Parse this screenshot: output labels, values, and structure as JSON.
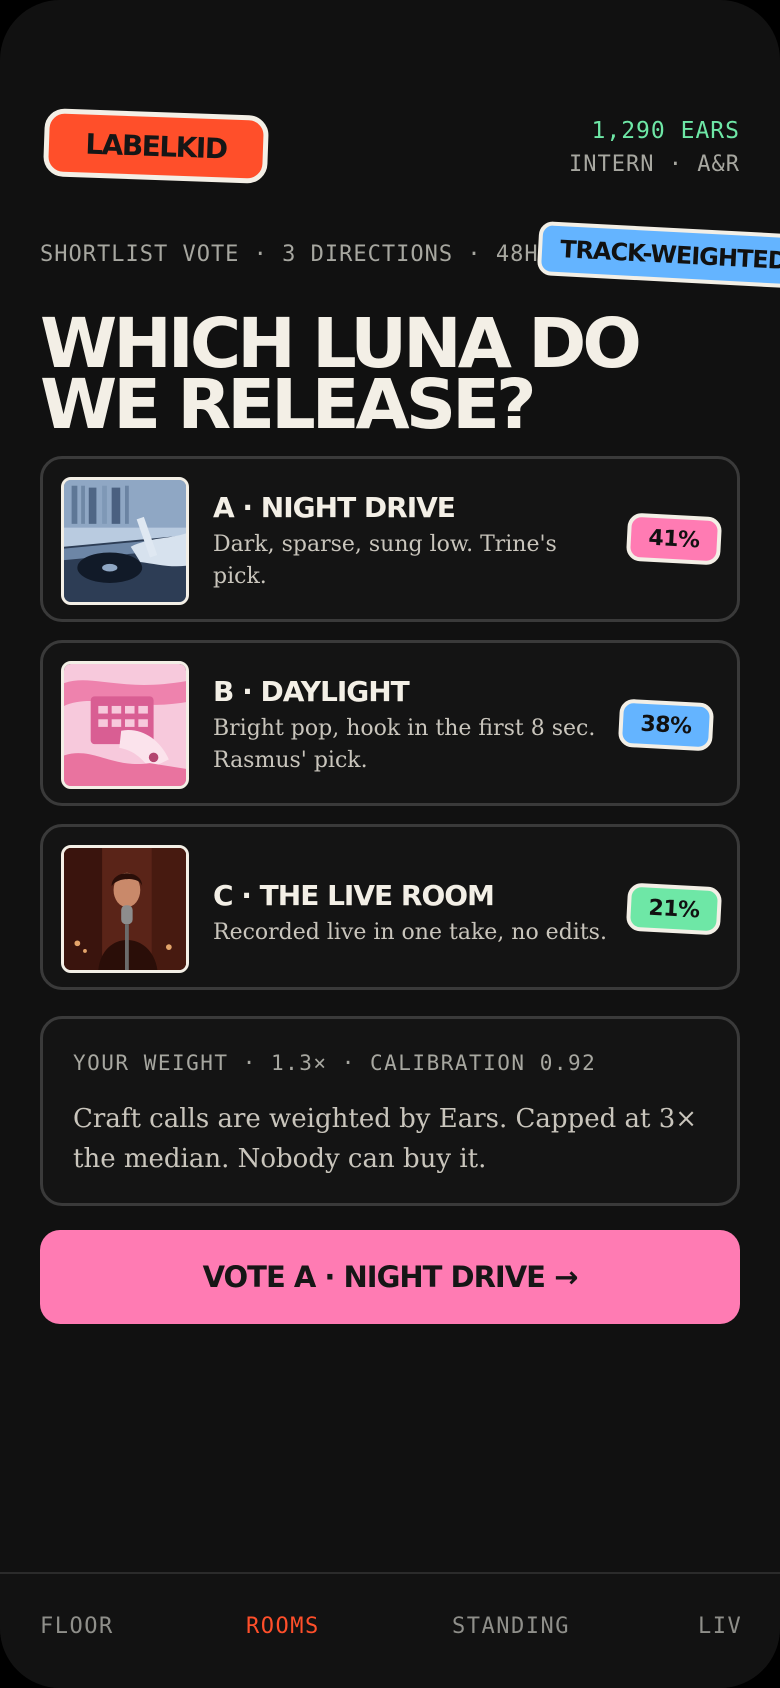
{
  "app": {
    "logo": "LABELKID"
  },
  "header": {
    "ears": "1,290 EARS",
    "role": "INTERN · A&R"
  },
  "meta": {
    "text": "SHORTLIST VOTE · 3 DIRECTIONS · 48H",
    "sticker": "TRACK-WEIGHTED"
  },
  "title": {
    "line1": "WHICH LUNA DO",
    "line2": "WE RELEASE?"
  },
  "options": [
    {
      "title": "A · NIGHT DRIVE",
      "desc": "Dark, sparse, sung low. Trine's pick.",
      "percent": "41%",
      "color": "#ff7bb3",
      "thumb": "turntable-image"
    },
    {
      "title": "B · DAYLIGHT",
      "desc": "Bright pop, hook in the first 8 sec. Rasmus' pick.",
      "percent": "38%",
      "color": "#64b4ff",
      "thumb": "drum-machine-image"
    },
    {
      "title": "C · THE LIVE ROOM",
      "desc": "Recorded live in one take, no edits.",
      "percent": "21%",
      "color": "#6ee7a6",
      "thumb": "singer-studio-image"
    }
  ],
  "weight": {
    "label": "YOUR WEIGHT · 1.3× · CALIBRATION 0.92",
    "text": "Craft calls are weighted by Ears. Capped at 3× the median. Nobody can buy it."
  },
  "vote_button": {
    "label": "VOTE A · NIGHT DRIVE →"
  },
  "nav": {
    "items": [
      "FLOOR",
      "ROOMS",
      "STANDING",
      "LIVE"
    ],
    "active": "ROOMS"
  }
}
